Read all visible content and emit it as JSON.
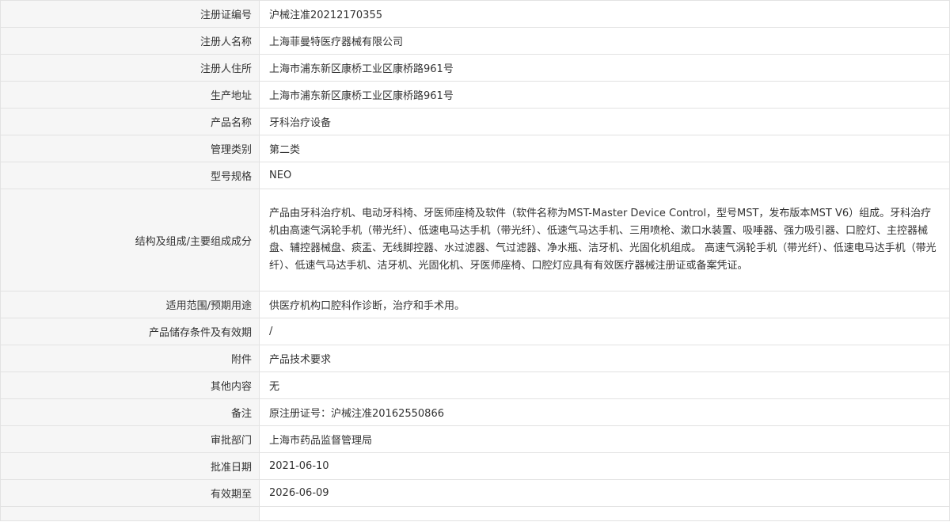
{
  "rows": [
    {
      "label": "注册证编号",
      "value": "沪械注准20212170355"
    },
    {
      "label": "注册人名称",
      "value": "上海菲曼特医疗器械有限公司"
    },
    {
      "label": "注册人住所",
      "value": "上海市浦东新区康桥工业区康桥路961号"
    },
    {
      "label": "生产地址",
      "value": "上海市浦东新区康桥工业区康桥路961号"
    },
    {
      "label": "产品名称",
      "value": "牙科治疗设备"
    },
    {
      "label": "管理类别",
      "value": "第二类"
    },
    {
      "label": "型号规格",
      "value": "NEO"
    },
    {
      "label": "结构及组成/主要组成成分",
      "value": "产品由牙科治疗机、电动牙科椅、牙医师座椅及软件（软件名称为MST-Master Device Control，型号MST，发布版本MST V6）组成。牙科治疗机由高速气涡轮手机（带光纤）、低速电马达手机（带光纤）、低速气马达手机、三用喷枪、漱口水装置、吸唾器、强力吸引器、口腔灯、主控器械盘、辅控器械盘、痰盂、无线脚控器、水过滤器、气过滤器、净水瓶、洁牙机、光固化机组成。 高速气涡轮手机（带光纤）、低速电马达手机（带光纤）、低速气马达手机、洁牙机、光固化机、牙医师座椅、口腔灯应具有有效医疗器械注册证或备案凭证。"
    },
    {
      "label": "适用范围/预期用途",
      "value": "供医疗机构口腔科作诊断，治疗和手术用。"
    },
    {
      "label": "产品储存条件及有效期",
      "value": "/"
    },
    {
      "label": "附件",
      "value": "产品技术要求"
    },
    {
      "label": "其他内容",
      "value": "无"
    },
    {
      "label": "备注",
      "value": "原注册证号：沪械注准20162550866"
    },
    {
      "label": "审批部门",
      "value": "上海市药品监督管理局"
    },
    {
      "label": "批准日期",
      "value": "2021-06-10"
    },
    {
      "label": "有效期至",
      "value": "2026-06-09"
    }
  ]
}
